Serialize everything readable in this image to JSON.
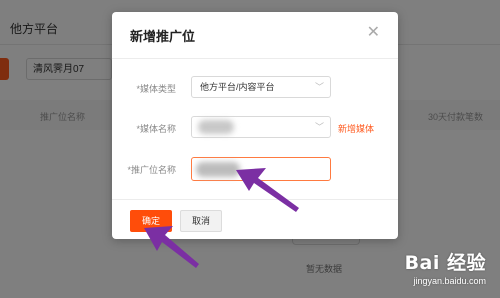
{
  "background": {
    "page_title": "他方平台",
    "filter_input_value": "清风霁月07",
    "table_headers": [
      "推广位名称",
      "30天付款笔数"
    ],
    "empty_text": "暂无数据"
  },
  "modal": {
    "title": "新增推广位",
    "close_icon": "close-icon",
    "fields": {
      "media_type": {
        "label": "*媒体类型",
        "value": "他方平台/内容平台"
      },
      "media_name": {
        "label": "*媒体名称",
        "value": ""
      },
      "position_name": {
        "label": "*推广位名称",
        "value": ""
      }
    },
    "new_media_link": "新增媒体",
    "confirm_label": "确定",
    "cancel_label": "取消"
  },
  "watermark": {
    "logo": "Bai 经验",
    "url": "jingyan.baidu.com"
  },
  "colors": {
    "accent": "#ff4d0a",
    "arrow": "#7b2fa3",
    "overlay": "rgba(0,0,0,0.5)"
  }
}
